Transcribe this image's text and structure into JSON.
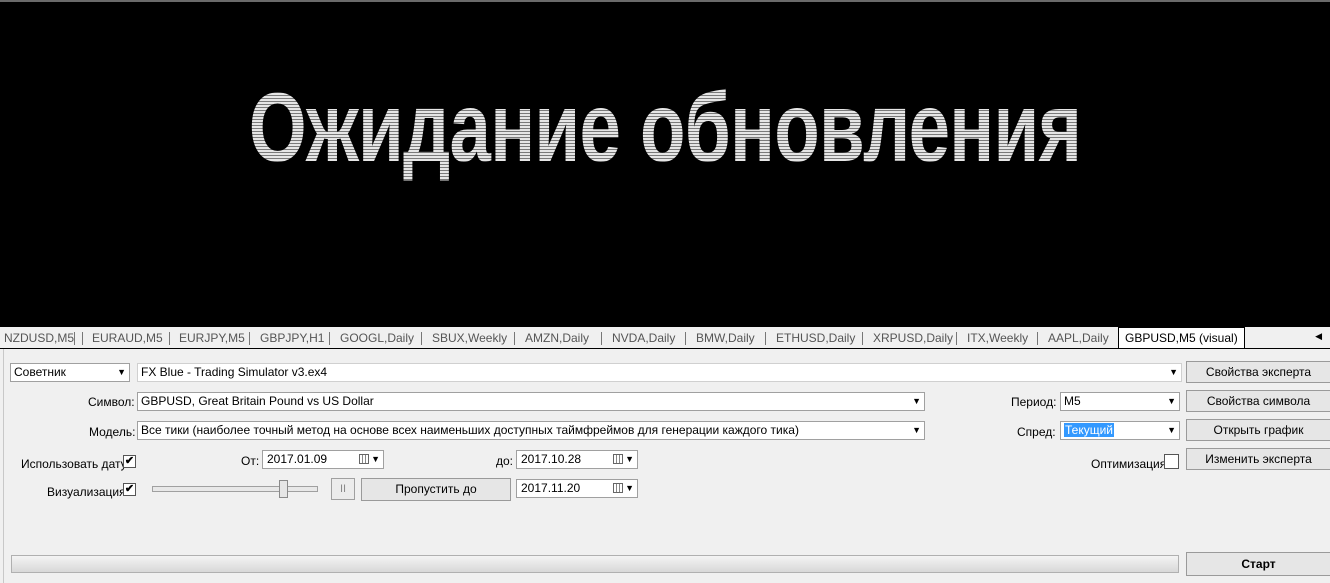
{
  "chart": {
    "wait_message": "Ожидание обновления"
  },
  "tabs": [
    "NZDUSD,M5",
    "EURAUD,M5",
    "EURJPY,M5",
    "GBPJPY,H1",
    "GOOGL,Daily",
    "SBUX,Weekly",
    "AMZN,Daily",
    "NVDA,Daily",
    "BMW,Daily",
    "ETHUSD,Daily",
    "XRPUSD,Daily",
    "ITX,Weekly",
    "AAPL,Daily",
    "GBPUSD,M5 (visual)"
  ],
  "tester": {
    "mode_value": "Советник",
    "expert_value": "FX Blue - Trading Simulator v3.ex4",
    "symbol_label": "Символ:",
    "symbol_value": "GBPUSD, Great Britain Pound vs US Dollar",
    "model_label": "Модель:",
    "model_value": "Все тики (наиболее точный метод на основе всех наименьших доступных таймфреймов для генерации каждого тика)",
    "use_date_label": "Использовать дату",
    "use_date_checked": "✔",
    "from_label": "От:",
    "from_value": "2017.01.09",
    "to_label": "до:",
    "to_value": "2017.10.28",
    "visual_label": "Визуализация",
    "visual_checked": "✔",
    "pause_glyph": "II",
    "skip_to_label": "Пропустить до",
    "skip_to_value": "2017.11.20",
    "period_label": "Период:",
    "period_value": "M5",
    "spread_label": "Спред:",
    "spread_value": "Текущий",
    "optimization_label": "Оптимизация"
  },
  "buttons": {
    "expert_properties": "Свойства эксперта",
    "symbol_properties": "Свойства символа",
    "open_chart": "Открыть график",
    "modify_expert": "Изменить эксперта",
    "start": "Старт"
  },
  "progress": 0
}
